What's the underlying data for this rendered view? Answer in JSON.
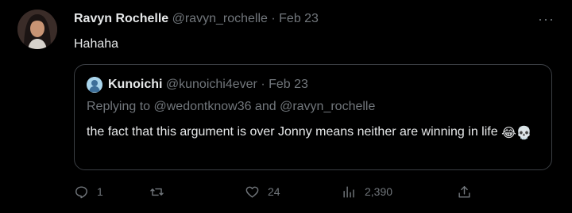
{
  "tweet": {
    "author_name": "Ravyn Rochelle",
    "author_handle": "@ravyn_rochelle",
    "separator": "·",
    "date": "Feb 23",
    "text": "Hahaha",
    "more_icon": "ellipsis-icon"
  },
  "quoted_tweet": {
    "author_name": "Kunoichi",
    "author_handle": "@kunoichi4ever",
    "separator": "·",
    "date": "Feb 23",
    "replying_prefix": "Replying to ",
    "reply_mention_1": "@wedontknow36",
    "reply_and": " and ",
    "reply_mention_2": "@ravyn_rochelle",
    "text": "the fact that this argument is over Jonny means neither are winning in life",
    "emoji_1": "😂",
    "emoji_2": "💀"
  },
  "actions": {
    "reply_count": "1",
    "retweet_count": "",
    "like_count": "24",
    "view_count": "2,390"
  },
  "colors": {
    "background": "#000000",
    "primary_text": "#e7e9ea",
    "secondary_text": "#71767b",
    "border": "#3b3f44"
  }
}
